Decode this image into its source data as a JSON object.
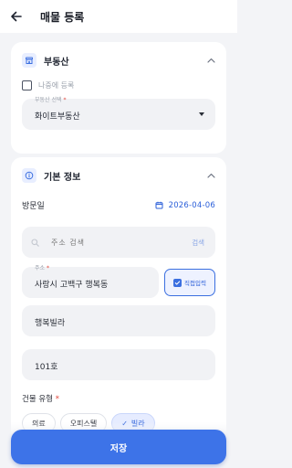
{
  "appbar": {
    "title": "매물 등록"
  },
  "real_estate_section": {
    "title": "부동산",
    "register_later_label": "나중에 등록",
    "agency_select": {
      "label": "부동산 선택",
      "required_mark": "*",
      "value": "화이트부동산"
    }
  },
  "basic_info_section": {
    "title": "기본 정보",
    "visit_date_label": "방문일",
    "visit_date_value": "2026-04-06",
    "address_search": {
      "placeholder": "주소 검색",
      "button_label": "검색"
    },
    "address_field": {
      "label": "주소",
      "required_mark": "*",
      "value": "사랑시 고백구 행복동"
    },
    "direct_input_label": "직접입력",
    "building_name_value": "행복빌라",
    "unit_value": "101호",
    "building_type": {
      "label": "건물 유형",
      "required_mark": "*",
      "options": [
        "의료",
        "오피스텔",
        "빌라"
      ],
      "selected": "빌라"
    }
  },
  "footer": {
    "save_label": "저장"
  },
  "colors": {
    "accent": "#3d73e8",
    "required": "#e0453a",
    "background": "#f3f4f7"
  }
}
